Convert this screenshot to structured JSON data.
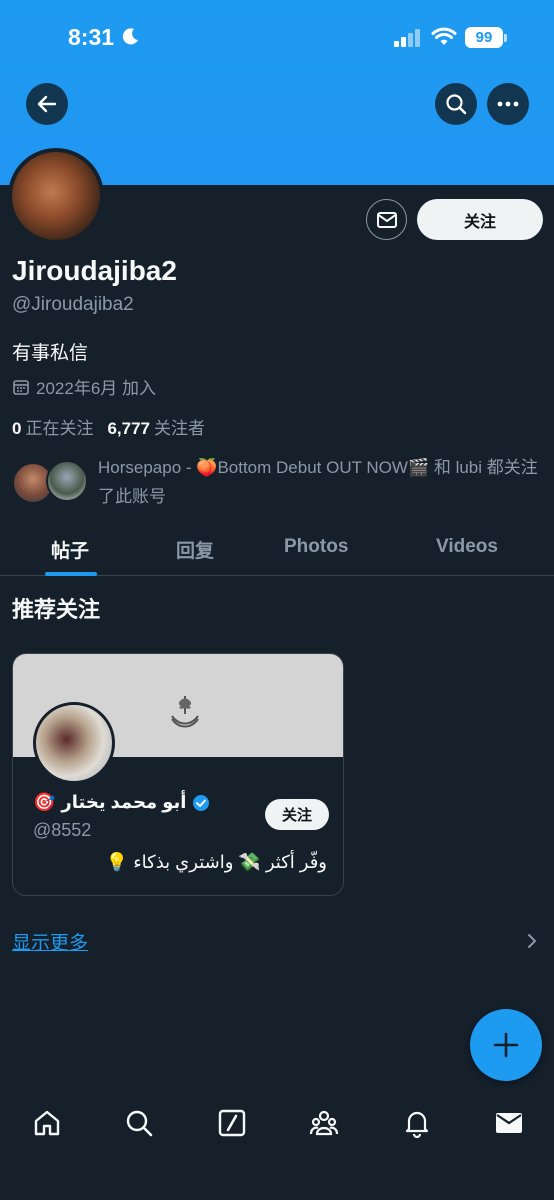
{
  "status_bar": {
    "time": "8:31",
    "battery": "99"
  },
  "profile": {
    "display_name": "Jiroudajiba2",
    "handle": "@Jiroudajiba2",
    "bio": "有事私信",
    "joined": "2022年6月 加入",
    "following_count": "0",
    "following_label": "正在关注",
    "followers_count": "6,777",
    "followers_label": "关注者",
    "followed_by_text": "Horsepapo - 🍑Bottom Debut OUT NOW🎬 和 lubi 都关注了此账号",
    "follow_label": "关注"
  },
  "tabs": [
    {
      "label": "帖子",
      "active": true
    },
    {
      "label": "回复",
      "active": false
    },
    {
      "label": "Photos",
      "active": false
    },
    {
      "label": "Videos",
      "active": false
    }
  ],
  "recommendations": {
    "title": "推荐关注",
    "cards": [
      {
        "name": "أبو محمد يختار",
        "name_emoji": "🎯",
        "handle": "@8552",
        "bio": "وفّر أكثر 💸 واشتري بذكاء 💡",
        "follow_label": "关注"
      }
    ],
    "show_more": "显示更多"
  },
  "colors": {
    "background": "#15202b",
    "accent": "#1d9bf0",
    "muted": "#8b98a5",
    "border": "#38444d"
  },
  "icons": {
    "back": "back-arrow-icon",
    "search": "search-icon",
    "more": "more-icon",
    "mail": "mail-icon",
    "calendar": "calendar-icon",
    "verified": "verified-badge-icon",
    "compose": "plus-icon",
    "nav": [
      "home-icon",
      "search-icon",
      "grok-icon",
      "communities-icon",
      "notifications-icon",
      "messages-icon"
    ]
  }
}
